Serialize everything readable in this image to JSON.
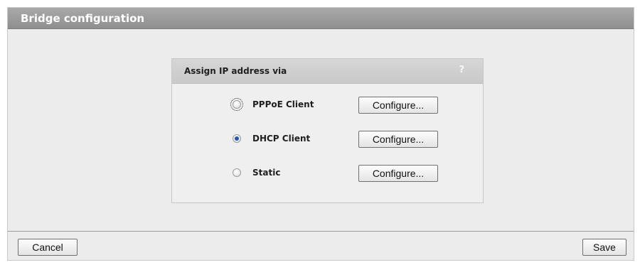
{
  "panel": {
    "title": "Bridge configuration"
  },
  "assign": {
    "title": "Assign IP address via",
    "help_icon": "?",
    "options": [
      {
        "label": "PPPoE Client",
        "selected": false,
        "focused": true,
        "button_label": "Configure..."
      },
      {
        "label": "DHCP Client",
        "selected": true,
        "focused": false,
        "button_label": "Configure..."
      },
      {
        "label": "Static",
        "selected": false,
        "focused": false,
        "button_label": "Configure..."
      }
    ]
  },
  "footer": {
    "cancel_label": "Cancel",
    "save_label": "Save"
  },
  "icons": {
    "help": "question-mark-icon",
    "radio": "radio-button-icon"
  },
  "colors": {
    "header": "#9a9a9a",
    "panel_background": "#ececec",
    "accent": "#2457a8"
  }
}
